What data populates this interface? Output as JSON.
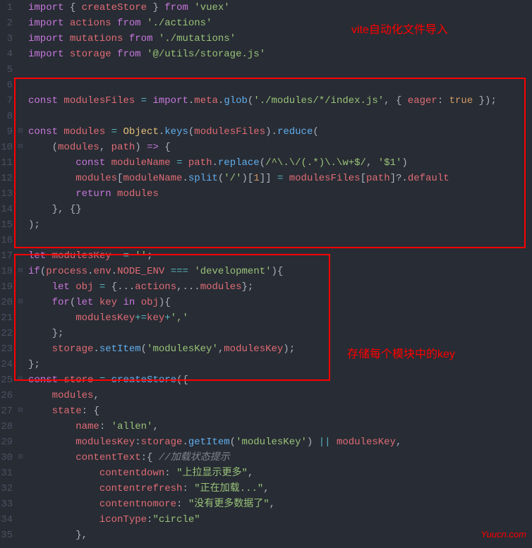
{
  "annotations": {
    "top": "vite自动化文件导入",
    "middle": "存储每个模块中的key",
    "watermark": "Yuucn.com"
  },
  "lines": [
    {
      "num": "1",
      "fold": "",
      "html": "<span class='kw'>import</span> <span class='punc'>{</span> <span class='var'>createStore</span> <span class='punc'>}</span> <span class='kw'>from</span> <span class='str'>'vuex'</span>"
    },
    {
      "num": "2",
      "fold": "",
      "html": "<span class='kw'>import</span> <span class='var'>actions</span> <span class='kw'>from</span> <span class='str'>'./actions'</span>"
    },
    {
      "num": "3",
      "fold": "",
      "html": "<span class='kw'>import</span> <span class='var'>mutations</span> <span class='kw'>from</span> <span class='str'>'./mutations'</span>"
    },
    {
      "num": "4",
      "fold": "",
      "html": "<span class='kw'>import</span> <span class='var'>storage</span> <span class='kw'>from</span> <span class='str'>'@/utils/storage.js'</span>"
    },
    {
      "num": "5",
      "fold": "",
      "html": ""
    },
    {
      "num": "6",
      "fold": "",
      "html": ""
    },
    {
      "num": "7",
      "fold": "",
      "html": "<span class='kw'>const</span> <span class='var'>modulesFiles</span> <span class='op'>=</span> <span class='kw'>import</span><span class='punc'>.</span><span class='prop'>meta</span><span class='punc'>.</span><span class='fn'>glob</span><span class='punc'>(</span><span class='str'>'./modules/*/index.js'</span><span class='punc'>,</span> <span class='punc'>{</span> <span class='prop'>eager</span><span class='punc'>:</span> <span class='const'>true</span> <span class='punc'>});</span>"
    },
    {
      "num": "8",
      "fold": "",
      "html": ""
    },
    {
      "num": "9",
      "fold": "⊟",
      "html": "<span class='kw'>const</span> <span class='var'>modules</span> <span class='op'>=</span> <span class='obj'>Object</span><span class='punc'>.</span><span class='fn'>keys</span><span class='punc'>(</span><span class='var'>modulesFiles</span><span class='punc'>).</span><span class='fn'>reduce</span><span class='punc'>(</span>"
    },
    {
      "num": "10",
      "fold": "⊟",
      "html": "    <span class='punc'>(</span><span class='param'>modules</span><span class='punc'>,</span> <span class='param'>path</span><span class='punc'>)</span> <span class='kw'>=></span> <span class='punc'>{</span>"
    },
    {
      "num": "11",
      "fold": "",
      "html": "        <span class='kw'>const</span> <span class='var'>moduleName</span> <span class='op'>=</span> <span class='var'>path</span><span class='punc'>.</span><span class='fn'>replace</span><span class='punc'>(</span><span class='str'>/^\\.\\/(.*)\\.\\w+$/</span><span class='punc'>,</span> <span class='str'>'$1'</span><span class='punc'>)</span>"
    },
    {
      "num": "12",
      "fold": "",
      "html": "        <span class='var'>modules</span><span class='punc'>[</span><span class='var'>moduleName</span><span class='punc'>.</span><span class='fn'>split</span><span class='punc'>(</span><span class='str'>'/'</span><span class='punc'>)[</span><span class='num'>1</span><span class='punc'>]]</span> <span class='op'>=</span> <span class='var'>modulesFiles</span><span class='punc'>[</span><span class='var'>path</span><span class='punc'>]?.</span><span class='prop'>default</span>"
    },
    {
      "num": "13",
      "fold": "",
      "html": "        <span class='kw'>return</span> <span class='var'>modules</span>"
    },
    {
      "num": "14",
      "fold": "",
      "html": "    <span class='punc'>},</span> <span class='punc'>{}</span>"
    },
    {
      "num": "15",
      "fold": "",
      "html": "<span class='punc'>);</span>"
    },
    {
      "num": "16",
      "fold": "",
      "html": ""
    },
    {
      "num": "17",
      "fold": "",
      "html": "<span class='kw'>let</span> <span class='var'>modulesKey</span>  <span class='op'>=</span> <span class='str'>''</span><span class='punc'>;</span>"
    },
    {
      "num": "18",
      "fold": "⊟",
      "html": "<span class='kw'>if</span><span class='punc'>(</span><span class='var'>process</span><span class='punc'>.</span><span class='prop'>env</span><span class='punc'>.</span><span class='prop'>NODE_ENV</span> <span class='op'>===</span> <span class='str'>'development'</span><span class='punc'>){</span>"
    },
    {
      "num": "19",
      "fold": "",
      "html": "    <span class='kw'>let</span> <span class='var'>obj</span> <span class='op'>=</span> <span class='punc'>{...</span><span class='var'>actions</span><span class='punc'>,...</span><span class='var'>modules</span><span class='punc'>};</span>"
    },
    {
      "num": "20",
      "fold": "⊟",
      "html": "    <span class='kw'>for</span><span class='punc'>(</span><span class='kw'>let</span> <span class='var'>key</span> <span class='kw'>in</span> <span class='var'>obj</span><span class='punc'>){</span>"
    },
    {
      "num": "21",
      "fold": "",
      "html": "        <span class='var'>modulesKey</span><span class='op'>+=</span><span class='var'>key</span><span class='op'>+</span><span class='str'>','</span>"
    },
    {
      "num": "22",
      "fold": "",
      "html": "    <span class='punc'>};</span>"
    },
    {
      "num": "23",
      "fold": "",
      "html": "    <span class='var'>storage</span><span class='punc'>.</span><span class='fn'>setItem</span><span class='punc'>(</span><span class='str'>'modulesKey'</span><span class='punc'>,</span><span class='var'>modulesKey</span><span class='punc'>);</span>"
    },
    {
      "num": "24",
      "fold": "",
      "html": "<span class='punc'>};</span>"
    },
    {
      "num": "25",
      "fold": "⊟",
      "html": "<span class='kw'>const</span> <span class='var'>store</span> <span class='op'>=</span> <span class='fn'>createStore</span><span class='punc'>({</span>"
    },
    {
      "num": "26",
      "fold": "",
      "html": "    <span class='var'>modules</span><span class='punc'>,</span>"
    },
    {
      "num": "27",
      "fold": "⊟",
      "html": "    <span class='prop'>state</span><span class='punc'>:</span> <span class='punc'>{</span>"
    },
    {
      "num": "28",
      "fold": "",
      "html": "        <span class='prop'>name</span><span class='punc'>:</span> <span class='str'>'allen'</span><span class='punc'>,</span>"
    },
    {
      "num": "29",
      "fold": "",
      "html": "        <span class='prop'>modulesKey</span><span class='punc'>:</span><span class='var'>storage</span><span class='punc'>.</span><span class='fn'>getItem</span><span class='punc'>(</span><span class='str'>'modulesKey'</span><span class='punc'>)</span> <span class='op'>||</span> <span class='var'>modulesKey</span><span class='punc'>,</span>"
    },
    {
      "num": "30",
      "fold": "⊟",
      "html": "        <span class='prop'>contentText</span><span class='punc'>:{</span> <span class='comment'>//加载状态提示</span>"
    },
    {
      "num": "31",
      "fold": "",
      "html": "            <span class='prop'>contentdown</span><span class='punc'>:</span> <span class='str'>\"上拉显示更多\"</span><span class='punc'>,</span>"
    },
    {
      "num": "32",
      "fold": "",
      "html": "            <span class='prop'>contentrefresh</span><span class='punc'>:</span> <span class='str'>\"正在加载...\"</span><span class='punc'>,</span>"
    },
    {
      "num": "33",
      "fold": "",
      "html": "            <span class='prop'>contentnomore</span><span class='punc'>:</span> <span class='str'>\"没有更多数据了\"</span><span class='punc'>,</span>"
    },
    {
      "num": "34",
      "fold": "",
      "html": "            <span class='prop'>iconType</span><span class='punc'>:</span><span class='str'>\"circle\"</span>"
    },
    {
      "num": "35",
      "fold": "",
      "html": "        <span class='punc'>},</span>"
    }
  ]
}
